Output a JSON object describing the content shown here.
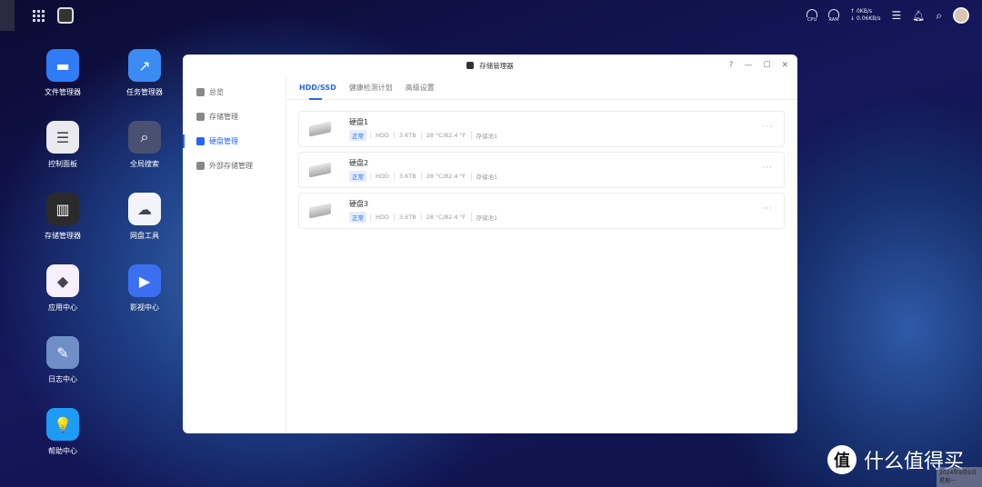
{
  "topbar": {
    "cpu": "CPU",
    "ram": "RAM",
    "upload": "↑ 0KB/s",
    "download": "↓ 0.06KB/s"
  },
  "desktop": [
    {
      "label": "文件管理器",
      "color": "#2f7cf6",
      "glyph": "▬"
    },
    {
      "label": "任务管理器",
      "color": "#3b8cf2",
      "glyph": "↗"
    },
    {
      "label": "控制面板",
      "color": "#e9e9ee",
      "glyph": "☰"
    },
    {
      "label": "全局搜索",
      "color": "#4a5170",
      "glyph": "⌕"
    },
    {
      "label": "存储管理器",
      "color": "#2a2a2a",
      "glyph": "▥"
    },
    {
      "label": "网盘工具",
      "color": "#f2f4fa",
      "glyph": "☁"
    },
    {
      "label": "应用中心",
      "color": "#f5f0fb",
      "glyph": "◆"
    },
    {
      "label": "影视中心",
      "color": "#3c6ff0",
      "glyph": "▶"
    },
    {
      "label": "日志中心",
      "color": "#6f8fc6",
      "glyph": "✎"
    },
    {
      "label": "",
      "color": "",
      "glyph": ""
    },
    {
      "label": "帮助中心",
      "color": "#1e9cf5",
      "glyph": "💡"
    }
  ],
  "window": {
    "title": "存储管理器",
    "help": "?",
    "minimize": "—",
    "maximize": "☐",
    "close": "✕",
    "sidebar": [
      {
        "label": "总览"
      },
      {
        "label": "存储管理"
      },
      {
        "label": "硬盘管理",
        "active": true
      },
      {
        "label": "外部存储管理"
      }
    ],
    "tabs": [
      {
        "label": "HDD/SSD",
        "active": true
      },
      {
        "label": "健康检测计划"
      },
      {
        "label": "高级设置"
      }
    ],
    "disks": [
      {
        "name": "硬盘1",
        "status": "正常",
        "type": "HDD",
        "size": "3.6TB",
        "temp": "28 °C/82.4 °F",
        "pool": "存储池1"
      },
      {
        "name": "硬盘2",
        "status": "正常",
        "type": "HDD",
        "size": "3.6TB",
        "temp": "28 °C/82.4 °F",
        "pool": "存储池1"
      },
      {
        "name": "硬盘3",
        "status": "正常",
        "type": "HDD",
        "size": "3.6TB",
        "temp": "28 °C/82.4 °F",
        "pool": "存储池1"
      }
    ],
    "more": "···"
  },
  "watermark": {
    "logo": "值",
    "text": "什么值得买"
  },
  "clock": {
    "date": "2024年9月9日",
    "weekday": "星期一"
  }
}
